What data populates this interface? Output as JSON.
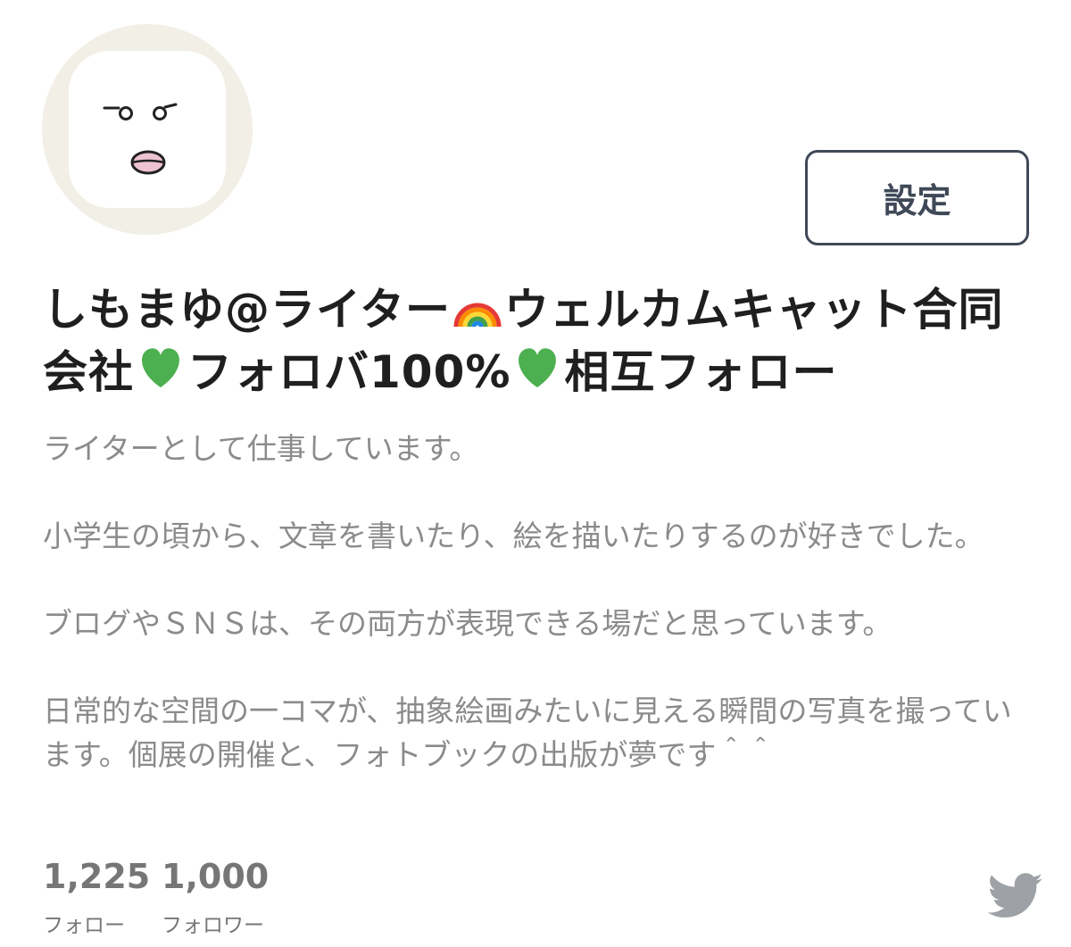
{
  "profile": {
    "name_parts": {
      "p1": "しもまゆ@ライター",
      "p2": "ウェルカムキャット合同会社",
      "p3": "フォロバ100%",
      "p4": "相互フォロー"
    },
    "emoji": {
      "rainbow": "rainbow-icon",
      "green_heart": "green-heart-icon"
    },
    "bio": [
      "ライターとして仕事しています。",
      "小学生の頃から、文章を書いたり、絵を描いたりするのが好きでした。",
      "ブログやＳＮＳは、その両方が表現できる場だと思っています。",
      "日常的な空間の一コマが、抽象絵画みたいに見える瞬間の写真を撮っています。個展の開催と、フォトブックの出版が夢です＾＾"
    ]
  },
  "actions": {
    "settings_label": "設定"
  },
  "stats": {
    "following": {
      "count": "1,225",
      "label": "フォロー"
    },
    "followers": {
      "count": "1,000",
      "label": "フォロワー"
    }
  },
  "icons": {
    "avatar": "avatar-face-illustration",
    "brand": "twitter-bird-icon"
  },
  "colors": {
    "button_border": "#3f4957",
    "bio_text": "#8b8b8b",
    "stats_text": "#767676",
    "twitter_icon": "#9ea1a5",
    "avatar_bg": "#f1efe6"
  }
}
